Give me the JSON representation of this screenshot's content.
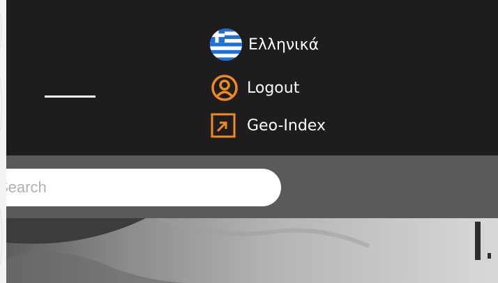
{
  "header": {
    "language": {
      "label": "Ελληνικά",
      "icon": "greek-flag-icon"
    },
    "logout": {
      "label": "Logout",
      "icon": "user-circle-icon"
    },
    "geo_index": {
      "label": "Geo-Index",
      "icon": "external-link-icon"
    }
  },
  "search": {
    "placeholder": "Search"
  },
  "colors": {
    "header_bg": "#1e1c1c",
    "accent": "#f08a1e",
    "search_bar_bg": "#5a5a5a",
    "flag_blue": "#1e6fd9"
  }
}
